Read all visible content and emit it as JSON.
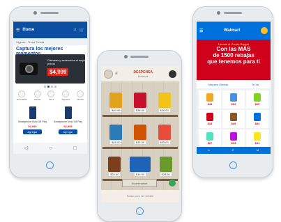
{
  "phone1": {
    "header": {
      "title": "Home"
    },
    "breadcrumb": "Vigente · Trend Tienda",
    "hero_title": "Captura los mejores momentos",
    "banner": {
      "caption": "Cámaras y accesorios al mejor precio",
      "price": "$4,999"
    },
    "categories": [
      {
        "label": "Novedades"
      },
      {
        "label": "Ofertas"
      },
      {
        "label": "Lalos"
      },
      {
        "label": "Juguetes"
      },
      {
        "label": "Ofertas"
      }
    ],
    "products": [
      {
        "name": "Smartphone Moto G8 Play",
        "price": "$2,999",
        "button": "Agregar"
      },
      {
        "name": "Smartphone Moto G8 Play",
        "price": "$2,999",
        "button": "Agregar"
      }
    ]
  },
  "phone2": {
    "header": {
      "title": "DESPENSA",
      "subtitle": "Botanas"
    },
    "shelves": [
      {
        "items": [
          {
            "price": "$40.99"
          },
          {
            "price": "$38.50"
          },
          {
            "price": "$36.00"
          }
        ]
      },
      {
        "items": [
          {
            "price": "$45.00"
          },
          {
            "price": "$33.50"
          },
          {
            "price": "$35.00"
          }
        ]
      },
      {
        "items": [
          {
            "price": "$32.00"
          },
          {
            "price": "$19.90"
          },
          {
            "price": "$28.50"
          }
        ]
      }
    ],
    "cart_label": "Supermarket",
    "footer_text": "Pulsa para ver detalle"
  },
  "phone3": {
    "header": {
      "brand": "Walmart"
    },
    "promo": {
      "tagline": "Llénate el Carrito Rápido",
      "line1": "Con las MÁS",
      "line2": "de 1500 rebajas",
      "line3": "que tenemos para ti"
    },
    "tabs": [
      "Mejores Ofertas",
      "Te Va"
    ],
    "grid": [
      {
        "price": "$34"
      },
      {
        "price": "$52"
      },
      {
        "price": "$29"
      },
      {
        "price": "$18"
      },
      {
        "price": "$45"
      },
      {
        "price": "$62"
      },
      {
        "price": "$27"
      },
      {
        "price": "$33"
      },
      {
        "price": "$41"
      }
    ]
  },
  "colors": {
    "liverpool_blue": "#0b4ea2",
    "walmart_blue": "#0071dc",
    "walmart_red": "#d0021b",
    "accent_red": "#e1251b"
  }
}
